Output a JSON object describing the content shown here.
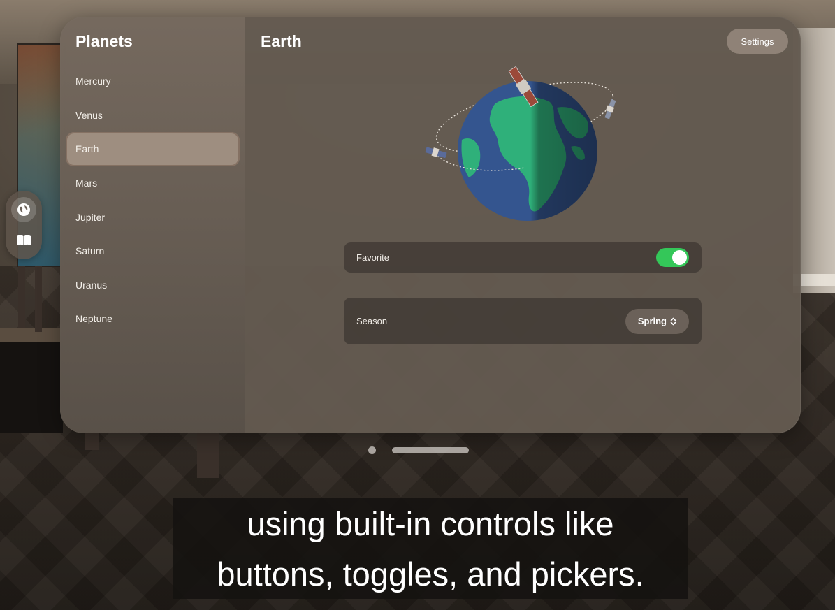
{
  "sidebar": {
    "title": "Planets",
    "items": [
      {
        "label": "Mercury"
      },
      {
        "label": "Venus"
      },
      {
        "label": "Earth",
        "selected": true
      },
      {
        "label": "Mars"
      },
      {
        "label": "Jupiter"
      },
      {
        "label": "Saturn"
      },
      {
        "label": "Uranus"
      },
      {
        "label": "Neptune"
      }
    ]
  },
  "ornament": {
    "tabs": [
      {
        "icon": "globe-icon",
        "active": true
      },
      {
        "icon": "book-icon",
        "active": false
      }
    ]
  },
  "detail": {
    "title": "Earth",
    "settings_label": "Settings",
    "favorite": {
      "label": "Favorite",
      "on": true
    },
    "season": {
      "label": "Season",
      "value": "Spring",
      "icon": "chevron-updown-icon"
    }
  },
  "colors": {
    "toggle_on": "#34c759",
    "ocean": "#34558f",
    "land": "#2fb07a"
  },
  "caption": {
    "line1": "using built-in controls like",
    "line2": "buttons, toggles, and pickers."
  }
}
